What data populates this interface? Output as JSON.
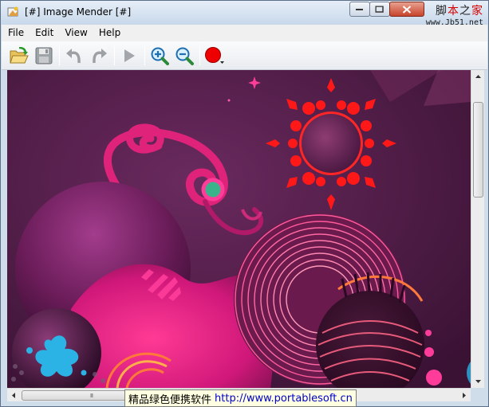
{
  "window": {
    "title": "[#] Image Mender [#]"
  },
  "watermark": {
    "site_text": "脚本之家",
    "url": "www.Jb51.net"
  },
  "menu": {
    "items": [
      "File",
      "Edit",
      "View",
      "Help"
    ]
  },
  "toolbar": {
    "buttons": [
      "open-icon",
      "save-icon",
      "undo-icon",
      "redo-icon",
      "run-icon",
      "zoom-in-icon",
      "zoom-out-icon",
      "color-picker-icon"
    ],
    "current_color": "#ee0000"
  },
  "scrollbars": {
    "horizontal_grip": "III"
  },
  "banner": {
    "text": "精品绿色便携软件",
    "url": "http://www.portablesoft.cn"
  },
  "colors": {
    "canvas_background": "#4e1d44",
    "accent_magenta": "#e0237a",
    "sun_red": "#ff1818",
    "splash_cyan": "#2bb3e6"
  }
}
